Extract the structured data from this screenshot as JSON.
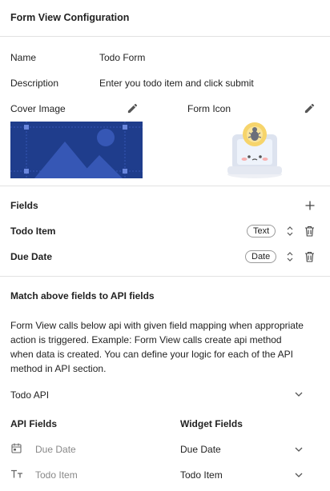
{
  "header": {
    "title": "Form View Configuration"
  },
  "config": {
    "name_label": "Name",
    "name_value": "Todo Form",
    "description_label": "Description",
    "description_value": "Enter you todo item and click submit",
    "cover_image_label": "Cover Image",
    "form_icon_label": "Form Icon"
  },
  "fields": {
    "title": "Fields",
    "items": [
      {
        "label": "Todo Item",
        "type": "Text"
      },
      {
        "label": "Due Date",
        "type": "Date"
      }
    ]
  },
  "mapping": {
    "title": "Match above fields to API fields",
    "description_lines": [
      "Form View calls below api with given field mapping when appropriate",
      "action is triggered. Example: Form View calls create api method",
      "when data is created. You can define your logic for each of the API",
      "method in API section."
    ],
    "api_select_value": "Todo API",
    "api_fields_header": "API Fields",
    "widget_fields_header": "Widget Fields",
    "rows": [
      {
        "api_field": "Due Date",
        "api_icon": "calendar-icon",
        "widget_field": "Due Date"
      },
      {
        "api_field": "Todo Item",
        "api_icon": "text-type-icon",
        "widget_field": "Todo Item"
      }
    ]
  },
  "colors": {
    "cover_bg": "#1f3d8c",
    "cover_mountain": "#3657b5",
    "icon_accent": "#f6d46b"
  }
}
